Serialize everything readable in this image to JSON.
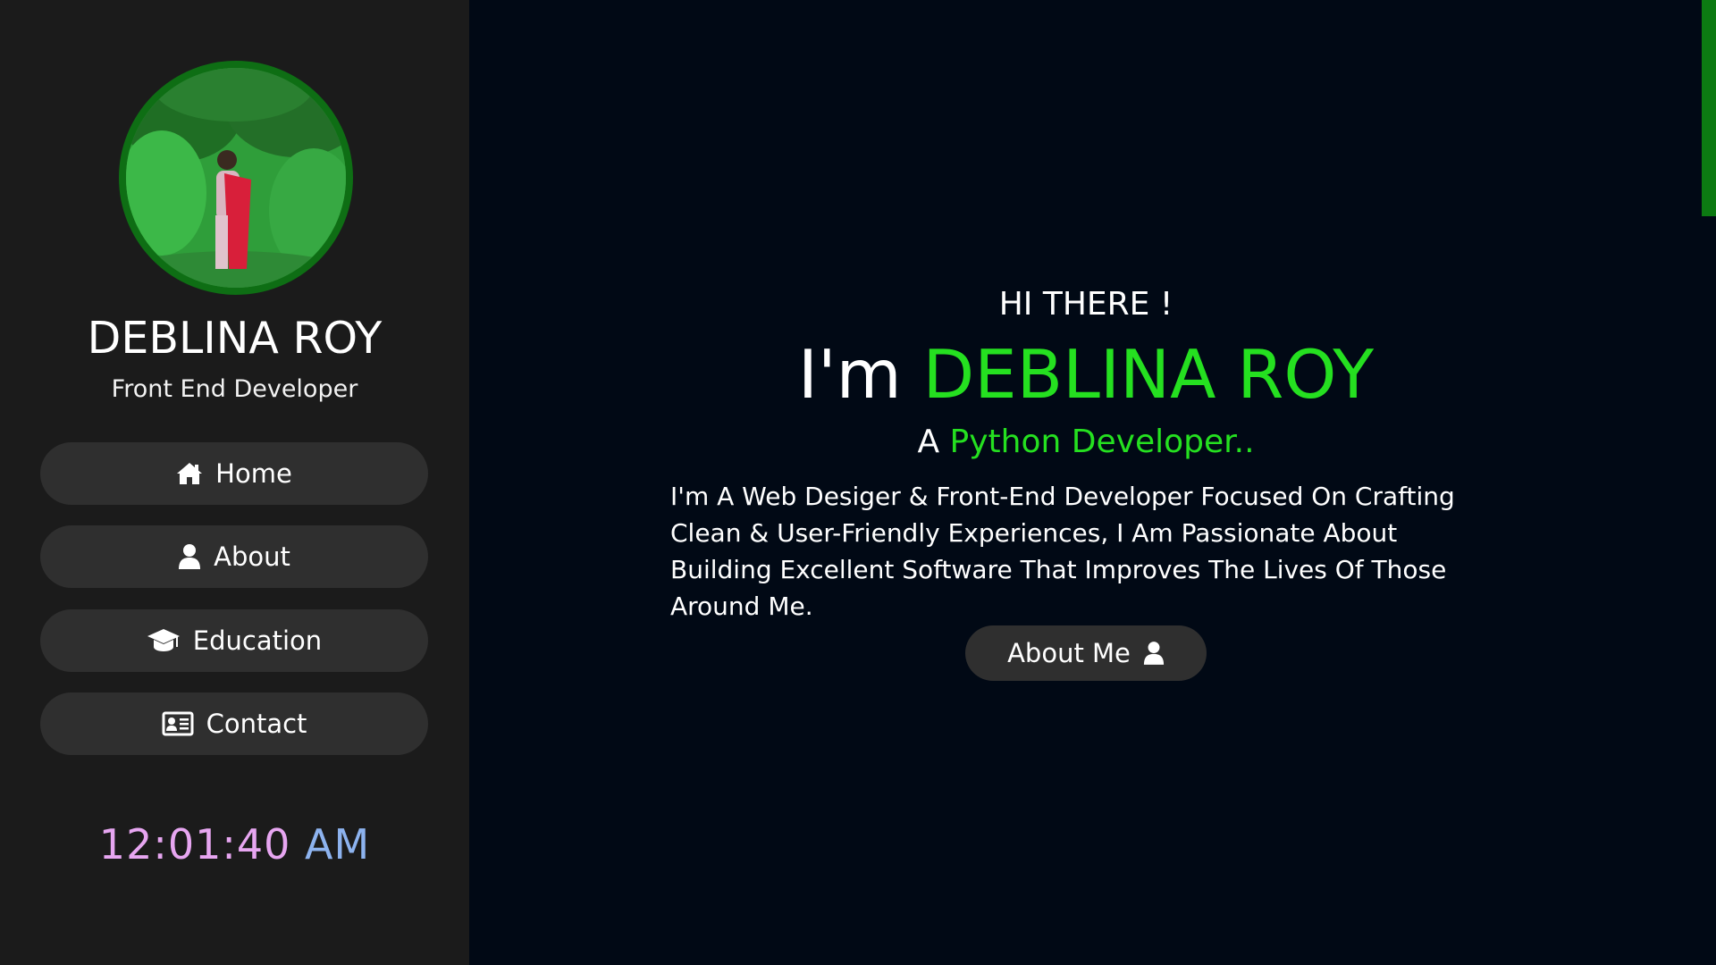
{
  "sidebar": {
    "name": "DEBLINA ROY",
    "role": "Front End Developer",
    "nav": [
      {
        "label": "Home",
        "icon": "home-icon"
      },
      {
        "label": "About",
        "icon": "user-icon"
      },
      {
        "label": "Education",
        "icon": "graduation-cap-icon"
      },
      {
        "label": "Contact",
        "icon": "contact-card-icon"
      }
    ],
    "clock": {
      "time": "12:01:40",
      "ampm": "AM"
    }
  },
  "hero": {
    "greeting": "HI THERE !",
    "intro_prefix": "I'm ",
    "intro_name": "DEBLINA ROY",
    "sub_prefix": "A ",
    "sub_role": "Python Developer..",
    "description": "I'm A Web Desiger & Front-End Developer Focused On Crafting Clean & User-Friendly Experiences, I Am Passionate About Building Excellent Software That Improves The Lives Of Those Around Me.",
    "button_label": "About Me"
  },
  "colors": {
    "accent_green": "#25e020",
    "sidebar_bg": "#1b1b1b",
    "main_bg": "#010915",
    "button_bg": "#2f2f2f",
    "clock_time": "#e7a6f1",
    "clock_ampm": "#8db3ef",
    "avatar_ring": "#0e6e14"
  }
}
